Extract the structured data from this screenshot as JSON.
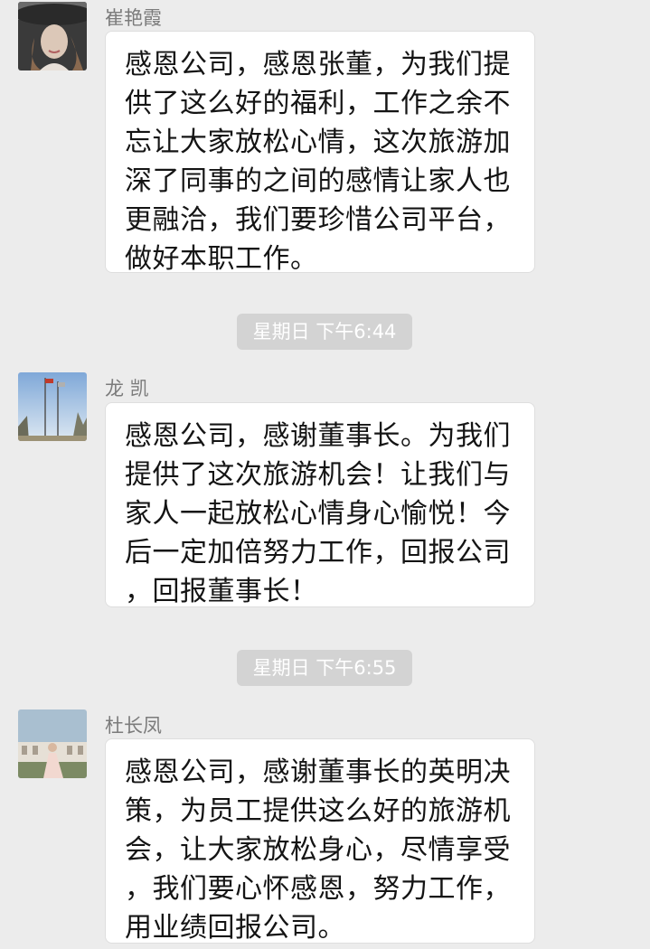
{
  "messages": [
    {
      "sender": "崔艳霞",
      "avatar_icon": "woman-with-hat-avatar",
      "text": "感恩公司，感恩张董，为我们提\n供了这么好的福利，工作之余不\n忘让大家放松心情，这次旅游加\n深了同事的之间的感情让家人也\n更融洽，我们要珍惜公司平台，\n做好本职工作。"
    },
    {
      "sender": "龙 凯",
      "avatar_icon": "flagpoles-sky-avatar",
      "text": "感恩公司，感谢董事长。为我们\n提供了这次旅游机会！让我们与\n家人一起放松心情身心愉悦！今\n后一定加倍努力工作，回报公司\n，回报董事长！"
    },
    {
      "sender": "杜长凤",
      "avatar_icon": "bride-building-avatar",
      "text": "感恩公司，感谢董事长的英明决\n策，为员工提供这么好的旅游机\n会，让大家放松身心，尽情享受\n，我们要心怀感恩，努力工作，\n用业绩回报公司。"
    }
  ],
  "timestamps": [
    "星期日 下午6:44",
    "星期日 下午6:55"
  ],
  "colors": {
    "background": "#ececec",
    "bubble": "#ffffff",
    "timestamp_bg": "#d3d3d3",
    "sender_text": "#7b7b7b"
  }
}
